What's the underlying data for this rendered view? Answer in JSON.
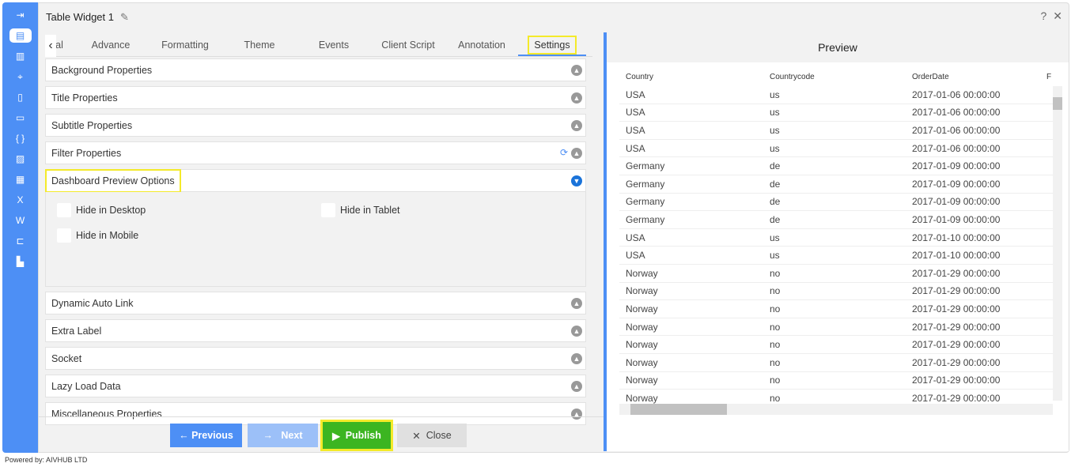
{
  "window": {
    "title": "Table Widget 1",
    "help": "?",
    "close": "✕"
  },
  "sidebar": {
    "icons": [
      "login-icon",
      "table-icon",
      "chart-icon",
      "map-icon",
      "report-icon",
      "contact-card-icon",
      "code-braces-icon",
      "image-chart-icon",
      "layout-icon",
      "excel-icon",
      "word-icon",
      "tree-icon",
      "bar-chart-icon"
    ]
  },
  "tabs": [
    {
      "label": "al"
    },
    {
      "label": "Advance"
    },
    {
      "label": "Formatting"
    },
    {
      "label": "Theme"
    },
    {
      "label": "Events"
    },
    {
      "label": "Client Script"
    },
    {
      "label": "Annotation"
    },
    {
      "label": "Settings"
    }
  ],
  "sections": {
    "background": "Background Properties",
    "title": "Title Properties",
    "subtitle": "Subtitle Properties",
    "filter": "Filter Properties",
    "dashboard": "Dashboard Preview Options",
    "dynamic": "Dynamic Auto Link",
    "extra": "Extra Label",
    "socket": "Socket",
    "lazy": "Lazy Load Data",
    "misc": "Miscellaneous Properties"
  },
  "options": {
    "desktop": "Hide in Desktop",
    "tablet": "Hide in Tablet",
    "mobile": "Hide in Mobile"
  },
  "buttons": {
    "previous": "Previous",
    "next": "Next",
    "publish": "Publish",
    "close": "Close"
  },
  "preview": {
    "title": "Preview",
    "columns": [
      "Country",
      "Countrycode",
      "OrderDate",
      "F"
    ],
    "rows": [
      [
        "USA",
        "us",
        "2017-01-06 00:00:00"
      ],
      [
        "USA",
        "us",
        "2017-01-06 00:00:00"
      ],
      [
        "USA",
        "us",
        "2017-01-06 00:00:00"
      ],
      [
        "USA",
        "us",
        "2017-01-06 00:00:00"
      ],
      [
        "Germany",
        "de",
        "2017-01-09 00:00:00"
      ],
      [
        "Germany",
        "de",
        "2017-01-09 00:00:00"
      ],
      [
        "Germany",
        "de",
        "2017-01-09 00:00:00"
      ],
      [
        "Germany",
        "de",
        "2017-01-09 00:00:00"
      ],
      [
        "USA",
        "us",
        "2017-01-10 00:00:00"
      ],
      [
        "USA",
        "us",
        "2017-01-10 00:00:00"
      ],
      [
        "Norway",
        "no",
        "2017-01-29 00:00:00"
      ],
      [
        "Norway",
        "no",
        "2017-01-29 00:00:00"
      ],
      [
        "Norway",
        "no",
        "2017-01-29 00:00:00"
      ],
      [
        "Norway",
        "no",
        "2017-01-29 00:00:00"
      ],
      [
        "Norway",
        "no",
        "2017-01-29 00:00:00"
      ],
      [
        "Norway",
        "no",
        "2017-01-29 00:00:00"
      ],
      [
        "Norway",
        "no",
        "2017-01-29 00:00:00"
      ],
      [
        "Norway",
        "no",
        "2017-01-29 00:00:00"
      ]
    ]
  },
  "footer": {
    "powered": "Powered by: AIVHUB LTD"
  },
  "colors": {
    "accent": "#4d8ff5",
    "publish": "#3cb521",
    "highlight": "#f4ea2a"
  }
}
